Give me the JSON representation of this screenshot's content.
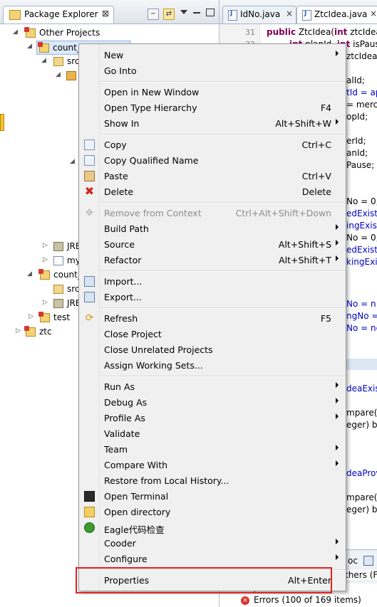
{
  "package_explorer": {
    "title": "Package Explorer",
    "close_glyph": "⊠",
    "tree": [
      {
        "label": "Other Projects",
        "icon": "working-set-icon"
      },
      {
        "label": "count_",
        "icon": "project-icon"
      },
      {
        "label": "src",
        "icon": "source-folder-icon"
      },
      {
        "label": "JRE",
        "icon": "library-icon"
      },
      {
        "label": "my",
        "icon": "file-icon"
      },
      {
        "label": "count_",
        "icon": "project-icon"
      },
      {
        "label": "src",
        "icon": "source-folder-icon"
      },
      {
        "label": "JRE",
        "icon": "library-icon"
      },
      {
        "label": "test",
        "icon": "project-icon"
      },
      {
        "label": "ztc",
        "icon": "project-icon"
      }
    ]
  },
  "editor": {
    "tabs": [
      {
        "label": "IdNo.java",
        "close": "×"
      },
      {
        "label": "ZtcIdea.java",
        "close": "×"
      }
    ],
    "line_numbers": [
      "31",
      "32"
    ],
    "code_lines": [
      {
        "pre": "",
        "kw": "public",
        "post": " ZtcIdea(",
        "kw2": "int",
        "post2": " ztcIdeaI"
      },
      {
        "pre": "    ",
        "kw": "int",
        "post": " planId, ",
        "kw2": "int",
        "post2": " isPaus"
      },
      {
        "text": "ztcIdea"
      },
      {
        "text": "alId;"
      },
      {
        "text": "tId = ap",
        "field": true
      },
      {
        "text": "= merc"
      },
      {
        "text": "opId;"
      },
      {
        "text": "erId;"
      },
      {
        "text": "anId;"
      },
      {
        "text": "Pause;"
      },
      {
        "text": "No = 0;"
      },
      {
        "text": "edExistN",
        "field": true
      },
      {
        "text": "ingExist",
        "field": true
      },
      {
        "text": "No = 0;"
      },
      {
        "text": "edExistN",
        "field": true
      },
      {
        "text": "kingExist",
        "field": true
      },
      {
        "text": "No = n",
        "field": true
      },
      {
        "text": "ngNo =",
        "field": true
      },
      {
        "text": "No = ne",
        "field": true
      },
      {
        "text": "deaExis",
        "field": true
      },
      {
        "text": "mpare(I"
      },
      {
        "text": "eger) b"
      },
      {
        "text": "deaProv",
        "field": true
      },
      {
        "text": "mpare(I"
      },
      {
        "text": "eger) b"
      }
    ],
    "bottom_tabs": [
      "oc",
      "thers (Fi"
    ],
    "problems_header": "Description",
    "problems_row": "Errors (100 of 169 items)"
  },
  "context_menu": {
    "items": [
      {
        "label": "New",
        "submenu": true
      },
      {
        "label": "Go Into"
      },
      {
        "sep": true
      },
      {
        "label": "Open in New Window"
      },
      {
        "label": "Open Type Hierarchy",
        "shortcut": "F4"
      },
      {
        "label": "Show In",
        "shortcut": "Alt+Shift+W",
        "submenu": true
      },
      {
        "sep": true
      },
      {
        "label": "Copy",
        "shortcut": "Ctrl+C",
        "icon": "copy-icon"
      },
      {
        "label": "Copy Qualified Name",
        "icon": "copy-qualified-icon"
      },
      {
        "label": "Paste",
        "shortcut": "Ctrl+V",
        "icon": "paste-icon"
      },
      {
        "label": "Delete",
        "shortcut": "Delete",
        "icon": "delete-icon"
      },
      {
        "sep": true
      },
      {
        "label": "Remove from Context",
        "shortcut": "Ctrl+Alt+Shift+Down",
        "disabled": true,
        "icon": "remove-context-icon"
      },
      {
        "label": "Build Path",
        "submenu": true
      },
      {
        "label": "Source",
        "shortcut": "Alt+Shift+S",
        "submenu": true
      },
      {
        "label": "Refactor",
        "shortcut": "Alt+Shift+T",
        "submenu": true
      },
      {
        "sep": true
      },
      {
        "label": "Import...",
        "icon": "import-icon"
      },
      {
        "label": "Export...",
        "icon": "export-icon"
      },
      {
        "sep": true
      },
      {
        "label": "Refresh",
        "shortcut": "F5",
        "icon": "refresh-icon"
      },
      {
        "label": "Close Project"
      },
      {
        "label": "Close Unrelated Projects"
      },
      {
        "label": "Assign Working Sets..."
      },
      {
        "sep": true
      },
      {
        "label": "Run As",
        "submenu": true
      },
      {
        "label": "Debug As",
        "submenu": true
      },
      {
        "label": "Profile As",
        "submenu": true
      },
      {
        "label": "Validate"
      },
      {
        "label": "Team",
        "submenu": true
      },
      {
        "label": "Compare With",
        "submenu": true
      },
      {
        "label": "Restore from Local History..."
      },
      {
        "label": "Open Terminal",
        "icon": "terminal-icon"
      },
      {
        "label": "Open directory",
        "icon": "folder-icon"
      },
      {
        "label": "Eagle代码检查",
        "icon": "bug-icon"
      },
      {
        "label": "Cooder",
        "submenu": true
      },
      {
        "label": "Configure",
        "submenu": true
      },
      {
        "sep": true
      },
      {
        "label": "Properties",
        "shortcut": "Alt+Enter"
      }
    ]
  },
  "colors": {
    "highlight_border": "#e02020",
    "menu_bg": "#f0f0f0",
    "keyword": "#7f0055",
    "field": "#0000c0"
  }
}
